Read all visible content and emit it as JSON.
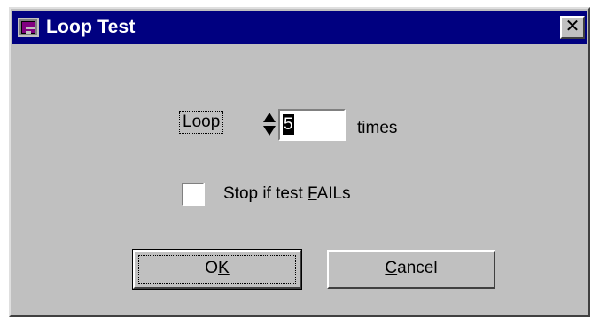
{
  "window": {
    "title": "Loop Test",
    "close_label": "✕"
  },
  "loop": {
    "label_pre": "",
    "label_underlined": "L",
    "label_post": "oop",
    "count_value": "5",
    "suffix": "times"
  },
  "stop_option": {
    "label_pre": "Stop if test ",
    "label_underlined": "F",
    "label_post": "AILs",
    "checked": false
  },
  "buttons": {
    "ok_pre": "O",
    "ok_underlined": "K",
    "ok_post": "",
    "cancel_pre": "",
    "cancel_underlined": "C",
    "cancel_post": "ancel"
  },
  "colors": {
    "titlebar": "#000080",
    "face": "#c0c0c0"
  }
}
